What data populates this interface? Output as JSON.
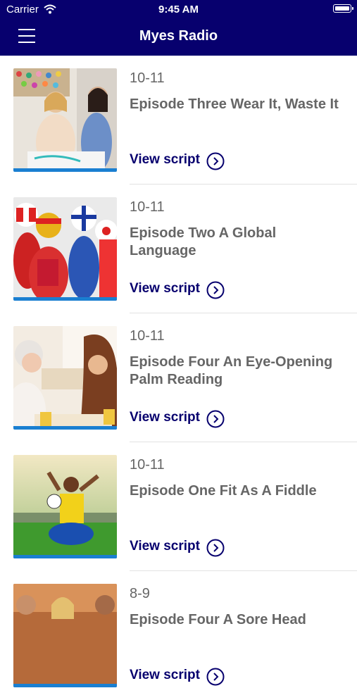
{
  "status_bar": {
    "carrier": "Carrier",
    "time": "9:45 AM"
  },
  "header": {
    "title": "Myes Radio",
    "menu_icon": "hamburger-menu-icon"
  },
  "episodes": [
    {
      "date": "10-11",
      "title": "Episode Three Wear It, Waste It",
      "action": "View script"
    },
    {
      "date": "10-11",
      "title": "Episode Two A Global Language",
      "action": "View script"
    },
    {
      "date": "10-11",
      "title": "Episode Four An Eye-Opening Palm Reading",
      "action": "View script"
    },
    {
      "date": "10-11",
      "title": "Episode One Fit As A Fiddle",
      "action": "View script"
    },
    {
      "date": "8-9",
      "title": "Episode Four A Sore Head",
      "action": "View script"
    }
  ],
  "colors": {
    "header_bg": "#07006e",
    "accent": "#07006e",
    "thumb_bar": "#1a7fd1",
    "text_gray": "#666666"
  }
}
